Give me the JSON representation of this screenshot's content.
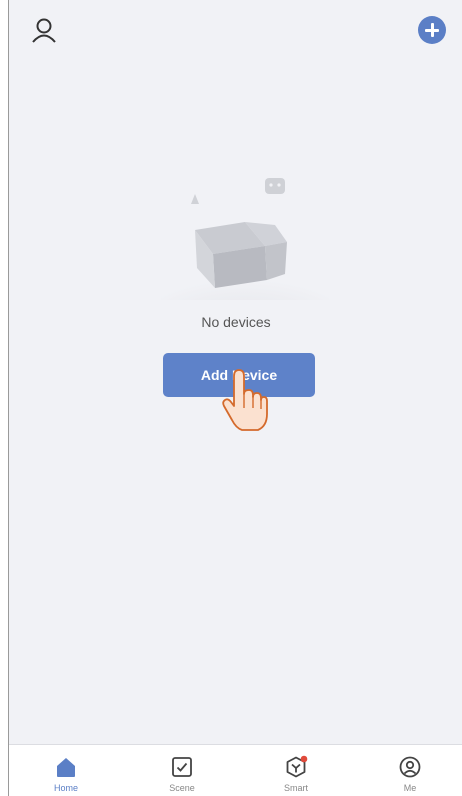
{
  "header": {
    "user_icon": "user-outline-icon",
    "add_icon": "plus-circle-icon",
    "accent_color": "#5b7fc6"
  },
  "empty_state": {
    "illustration": "empty-box-icon",
    "message": "No devices",
    "button_label": "Add Device",
    "button_color": "#5e82c9",
    "overlay": "pointing-hand-icon"
  },
  "tabbar": {
    "tabs": [
      {
        "label": "Home",
        "icon": "home-icon",
        "active": true
      },
      {
        "label": "Scene",
        "icon": "checkbox-icon",
        "active": false
      },
      {
        "label": "Smart",
        "icon": "smart-cube-icon",
        "active": false,
        "badge_color": "#e04a3b"
      },
      {
        "label": "Me",
        "icon": "profile-icon",
        "active": false
      }
    ]
  }
}
